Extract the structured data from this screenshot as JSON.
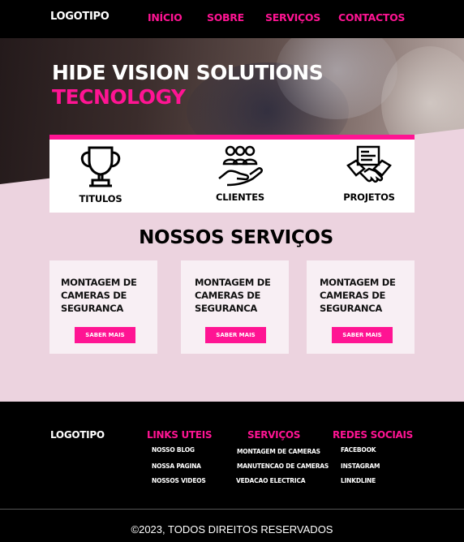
{
  "nav": {
    "logo": "LOGOTIPO",
    "links": [
      "INÍCIO",
      "SOBRE",
      "SERVIÇOS",
      "CONTACTOS"
    ]
  },
  "hero": {
    "title": "HIDE VISION SOLUTIONS",
    "subtitle": "TECNOLOGY"
  },
  "stats": [
    {
      "label": "TITULOS",
      "icon": "trophy-icon"
    },
    {
      "label": "CLIENTES",
      "icon": "clients-handshake-icon"
    },
    {
      "label": "PROJETOS",
      "icon": "projects-handshake-icon"
    }
  ],
  "services": {
    "title": "NOSSOS SERVIÇOS",
    "cards": [
      {
        "title": "MONTAGEM DE CAMERAS DE SEGURANCA",
        "button": "SABER MAIS"
      },
      {
        "title": "MONTAGEM DE CAMERAS DE SEGURANCA",
        "button": "SABER MAIS"
      },
      {
        "title": "MONTAGEM DE CAMERAS DE SEGURANCA",
        "button": "SABER MAIS"
      }
    ]
  },
  "footer": {
    "logo": "LOGOTIPO",
    "columns": [
      {
        "heading": "LINKS UTEIS",
        "items": [
          "NOSSO BLOG",
          "NOSSA PAGINA",
          "NOSSOS VIDEOS"
        ]
      },
      {
        "heading": "SERVIÇOS",
        "items": [
          "MONTAGEM DE CAMERAS",
          "MANUTENCAO DE CAMERAS",
          "VEDACAO ELECTRICA"
        ]
      },
      {
        "heading": "REDES SOCIAIS",
        "items": [
          "FACEBOOK",
          "INSTAGRAM",
          "LINKDLINE"
        ]
      }
    ],
    "copyright": "©2023, TODOS DIREITOS RESERVADOS"
  },
  "colors": {
    "accent": "#ff1493",
    "background": "#ecd3df",
    "dark": "#000000"
  }
}
